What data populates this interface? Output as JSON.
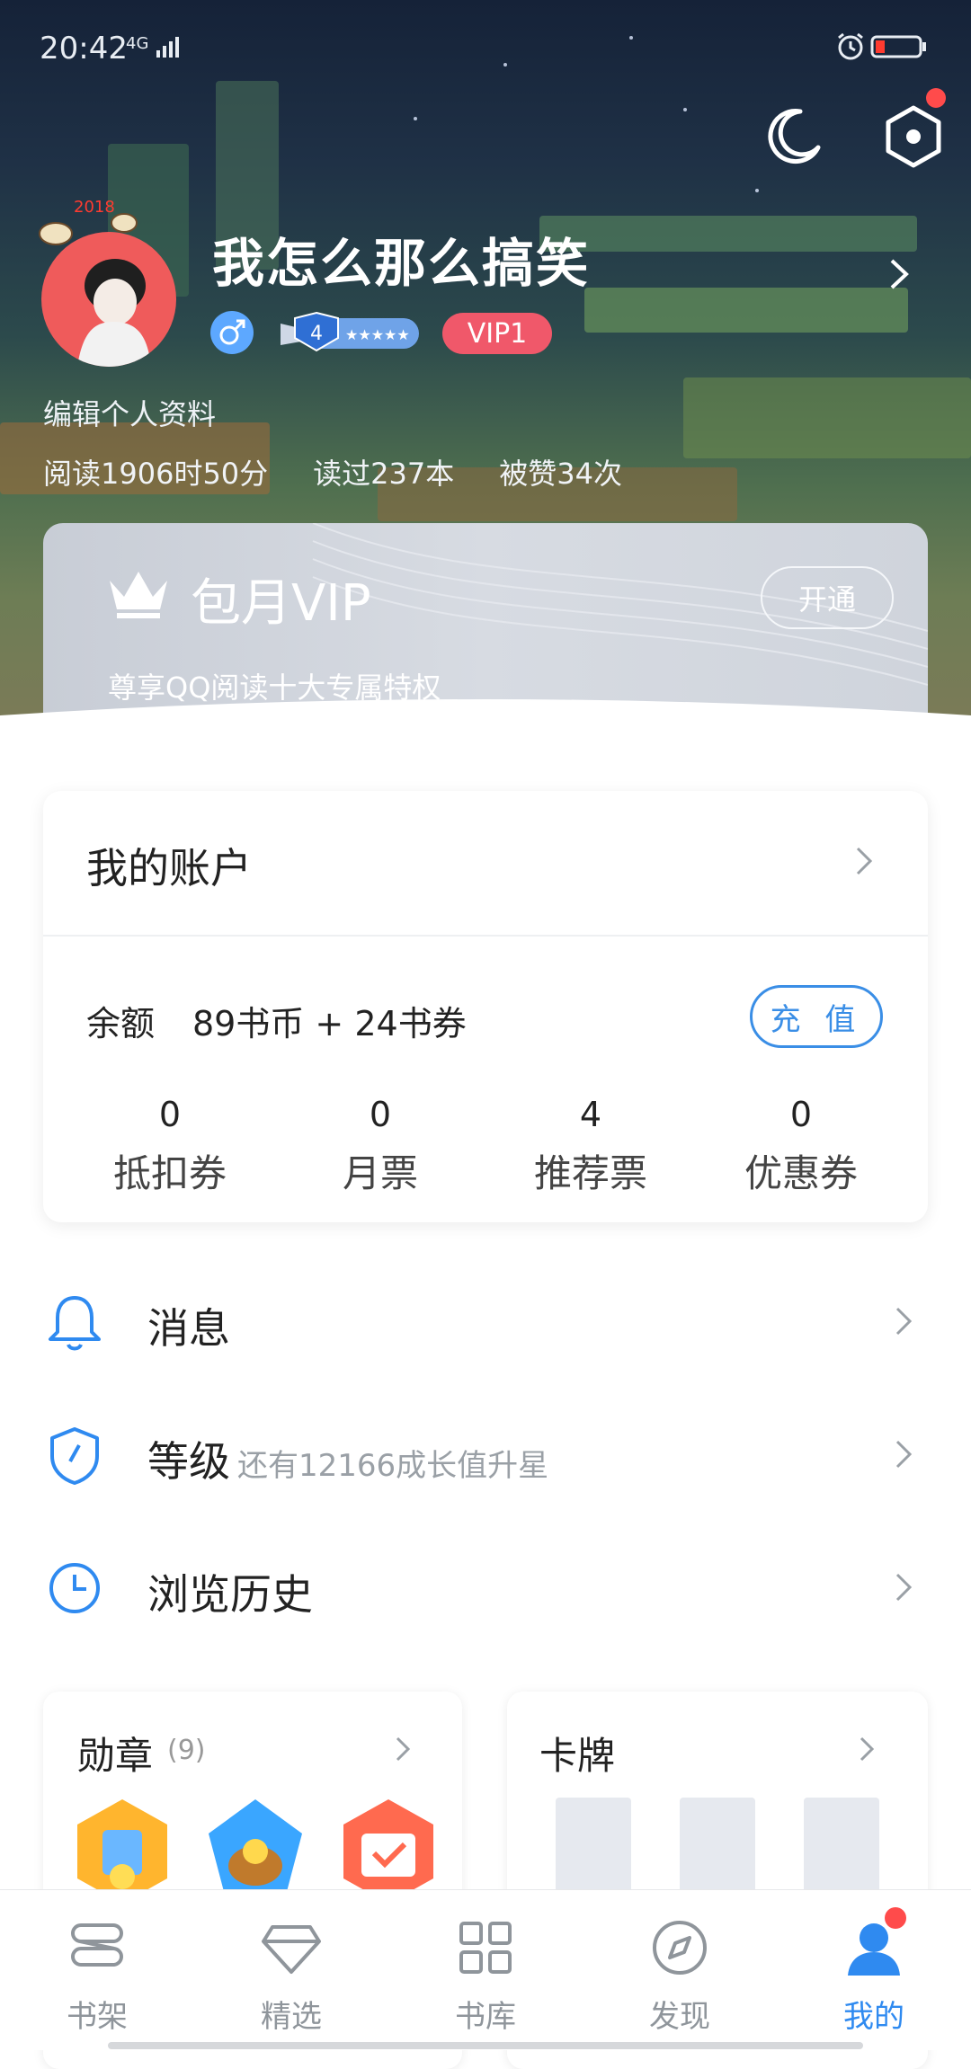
{
  "status_bar": {
    "time": "20:42",
    "network": "4G"
  },
  "profile": {
    "username": "我怎么那么搞笑",
    "level": "4",
    "vip_badge": "VIP1",
    "edit_label": "编辑个人资料",
    "avatar_year": "2018",
    "stats": [
      "阅读1906时50分",
      "读过237本",
      "被赞34次"
    ]
  },
  "vip_card": {
    "title": "包月VIP",
    "subtitle": "尊享QQ阅读十大专属特权",
    "open_button": "开通"
  },
  "account": {
    "title": "我的账户",
    "balance_label": "余额",
    "balance_value": "89书币 + 24书券",
    "recharge_button": "充 值",
    "stats": [
      {
        "value": "0",
        "label": "抵扣券"
      },
      {
        "value": "0",
        "label": "月票"
      },
      {
        "value": "4",
        "label": "推荐票"
      },
      {
        "value": "0",
        "label": "优惠券"
      }
    ]
  },
  "menu": [
    {
      "label": "消息",
      "sub": "",
      "icon": "bell-icon"
    },
    {
      "label": "等级",
      "sub": "还有12166成长值升星",
      "icon": "shield-icon"
    },
    {
      "label": "浏览历史",
      "sub": "",
      "icon": "clock-icon"
    }
  ],
  "medals": {
    "title": "勋章",
    "count": "(9)"
  },
  "cards": {
    "title": "卡牌"
  },
  "bottom_nav": [
    {
      "label": "书架",
      "icon": "bookshelf-icon"
    },
    {
      "label": "精选",
      "icon": "diamond-icon"
    },
    {
      "label": "书库",
      "icon": "grid-icon"
    },
    {
      "label": "发现",
      "icon": "compass-icon"
    },
    {
      "label": "我的",
      "icon": "user-icon",
      "active": true
    }
  ],
  "colors": {
    "accent": "#2f8af0",
    "vip_pill": "#f0586a",
    "notification_dot": "#ff4b4b"
  }
}
